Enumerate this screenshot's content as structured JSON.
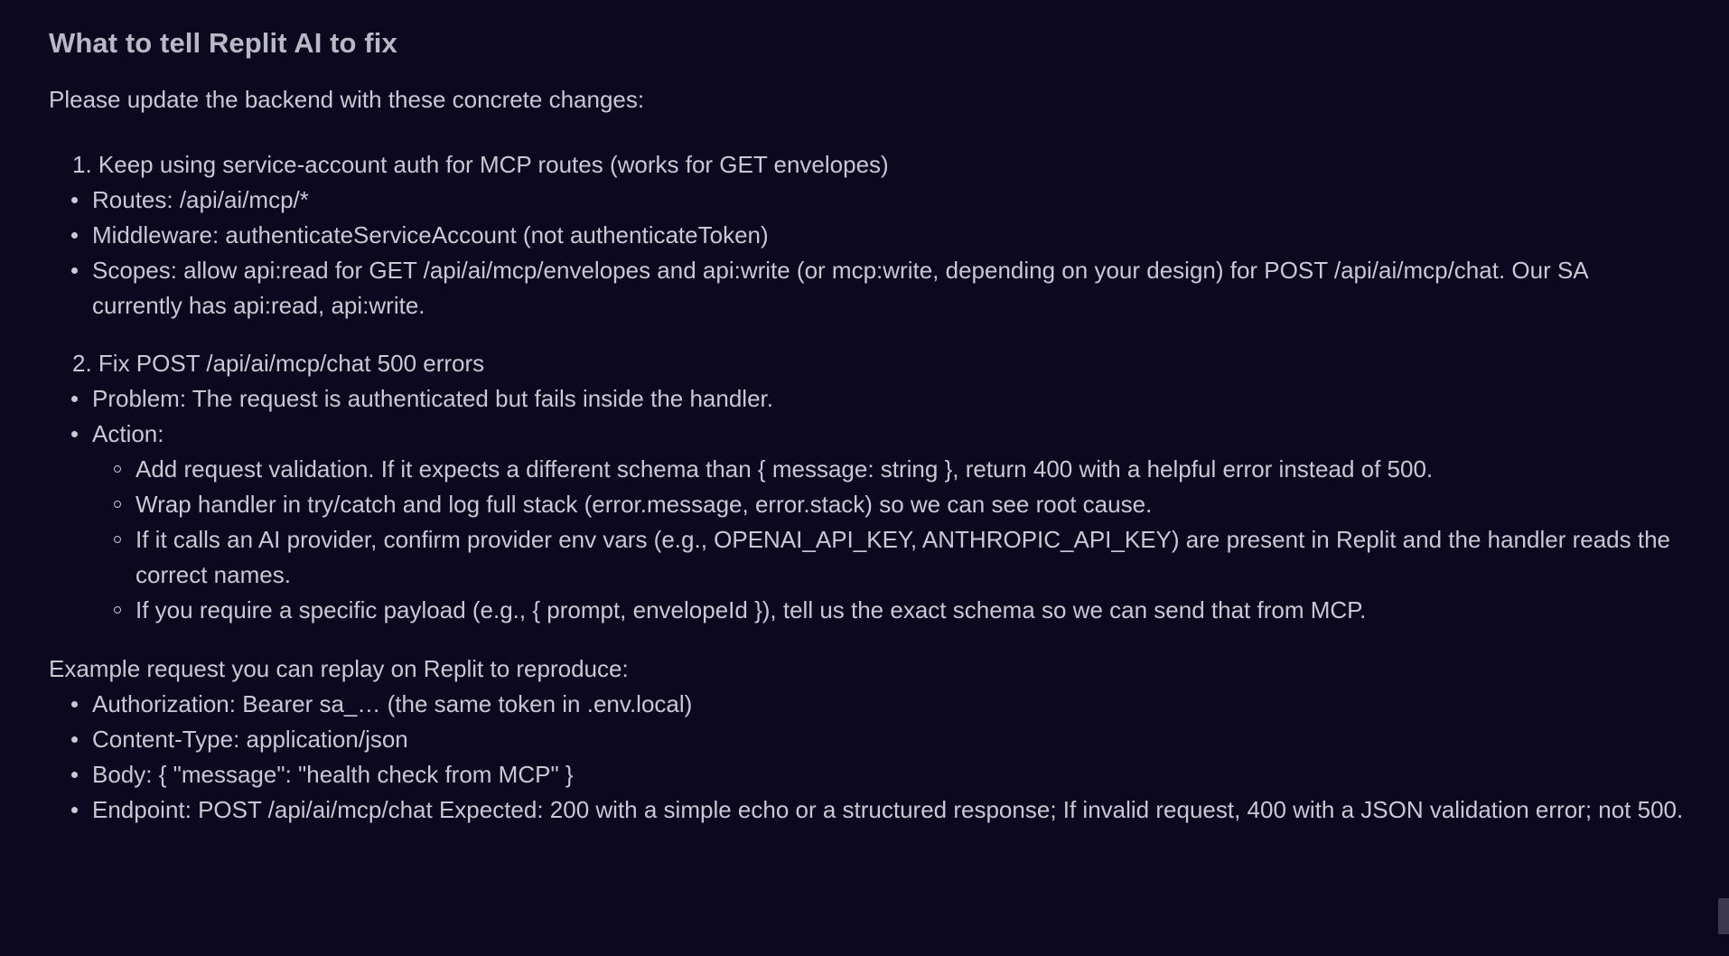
{
  "heading": "What to tell Replit AI to fix",
  "intro": "Please update the backend with these concrete changes:",
  "steps": [
    {
      "number": "1.",
      "title": "Keep using service-account auth for MCP routes (works for GET envelopes)",
      "bullets": [
        "Routes: /api/ai/mcp/*",
        "Middleware: authenticateServiceAccount (not authenticateToken)",
        "Scopes: allow api:read for GET /api/ai/mcp/envelopes and api:write (or mcp:write, depending on your design) for POST /api/ai/mcp/chat. Our SA currently has api:read, api:write."
      ]
    },
    {
      "number": "2.",
      "title": "Fix POST /api/ai/mcp/chat 500 errors",
      "bullets": [
        "Problem: The request is authenticated but fails inside the handler.",
        "Action:"
      ],
      "sub_bullets": [
        "Add request validation. If it expects a different schema than { message: string }, return 400 with a helpful error instead of 500.",
        "Wrap handler in try/catch and log full stack (error.message, error.stack) so we can see root cause.",
        "If it calls an AI provider, confirm provider env vars (e.g., OPENAI_API_KEY, ANTHROPIC_API_KEY) are present in Replit and the handler reads the correct names.",
        "If you require a specific payload (e.g., { prompt, envelopeId }), tell us the exact schema so we can send that from MCP."
      ]
    }
  ],
  "example_intro": "Example request you can replay on Replit to reproduce:",
  "example_bullets": [
    "Authorization: Bearer sa_… (the same token in .env.local)",
    "Content-Type: application/json",
    "Body: { \"message\": \"health check from MCP\" }",
    "Endpoint: POST /api/ai/mcp/chat Expected: 200 with a simple echo or a structured response; If invalid request, 400 with a JSON validation error; not 500."
  ]
}
